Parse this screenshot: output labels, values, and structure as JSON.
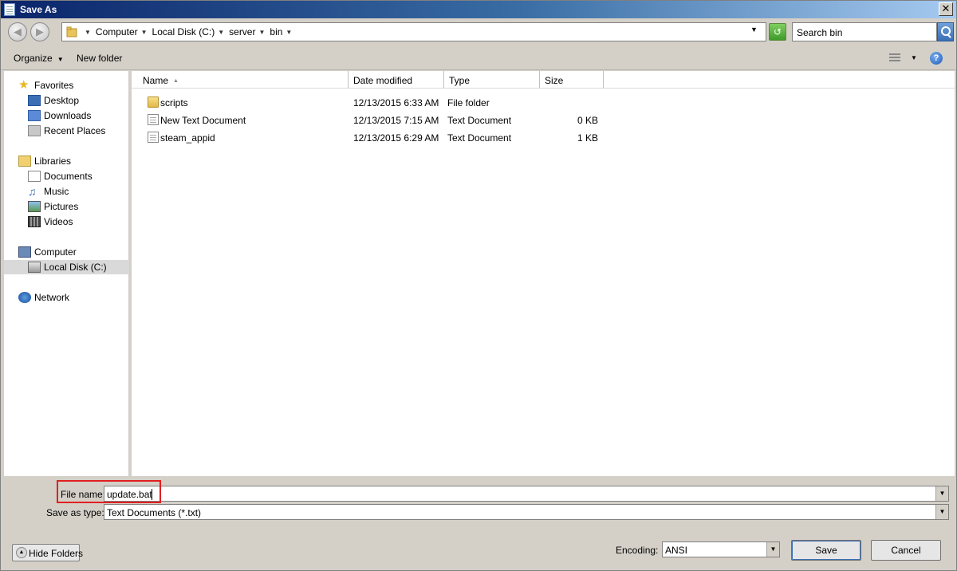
{
  "window": {
    "title": "Save As",
    "close_glyph": "✕"
  },
  "address": {
    "crumbs": [
      "Computer",
      "Local Disk (C:)",
      "server",
      "bin"
    ],
    "search_placeholder": "Search bin"
  },
  "toolbar": {
    "organize": "Organize",
    "new_folder": "New folder",
    "help_glyph": "?"
  },
  "nav": {
    "favorites": "Favorites",
    "desktop": "Desktop",
    "downloads": "Downloads",
    "recent_places": "Recent Places",
    "libraries": "Libraries",
    "documents": "Documents",
    "music": "Music",
    "pictures": "Pictures",
    "videos": "Videos",
    "computer": "Computer",
    "local_disk": "Local Disk (C:)",
    "network": "Network"
  },
  "columns": {
    "name": "Name",
    "date": "Date modified",
    "type": "Type",
    "size": "Size"
  },
  "files": [
    {
      "name": "scripts",
      "date": "12/13/2015 6:33 AM",
      "type": "File folder",
      "size": "",
      "icon": "folder-icon"
    },
    {
      "name": "New Text Document",
      "date": "12/13/2015 7:15 AM",
      "type": "Text Document",
      "size": "0 KB",
      "icon": "text-file-icon"
    },
    {
      "name": "steam_appid",
      "date": "12/13/2015 6:29 AM",
      "type": "Text Document",
      "size": "1 KB",
      "icon": "text-file-icon"
    }
  ],
  "form": {
    "file_name_label": "File name:",
    "file_name_value": "update.bat",
    "save_type_label": "Save as type:",
    "save_type_value": "Text Documents (*.txt)",
    "encoding_label": "Encoding:",
    "encoding_value": "ANSI",
    "hide_folders": "Hide Folders",
    "save": "Save",
    "cancel": "Cancel"
  },
  "colors": {
    "highlight": "#e02020",
    "titlebar": "#0a246a",
    "selected_nav": "#d9d9d9"
  }
}
